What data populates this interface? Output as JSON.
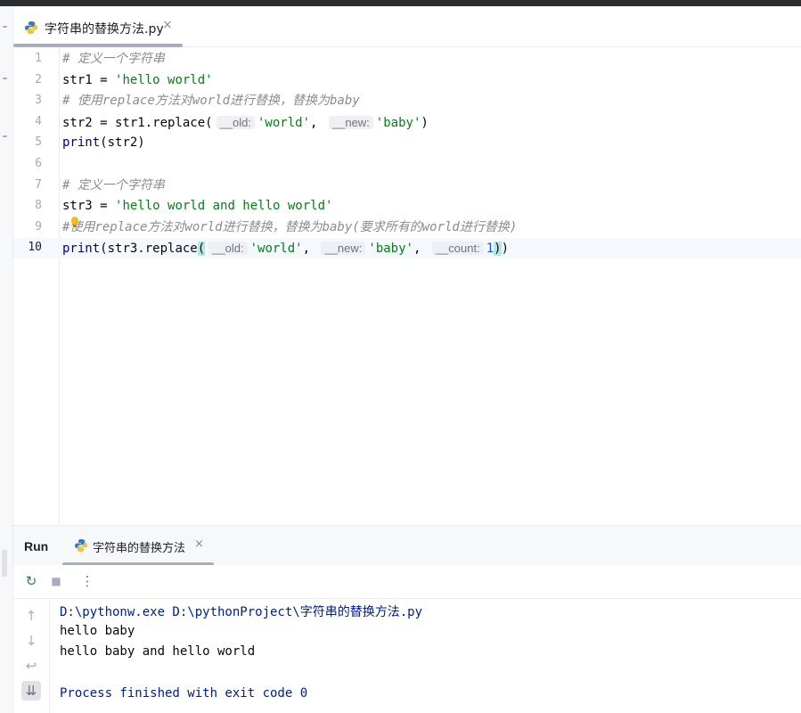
{
  "editor": {
    "tab": {
      "title": "字符串的替换方法.py",
      "close": "×"
    },
    "lines": [
      {
        "num": "1",
        "tokens": [
          {
            "t": "# 定义一个字符串",
            "c": "cm"
          }
        ]
      },
      {
        "num": "2",
        "tokens": [
          {
            "t": "str1 = ",
            "c": ""
          },
          {
            "t": "'hello world'",
            "c": "str"
          }
        ]
      },
      {
        "num": "3",
        "tokens": [
          {
            "t": "# 使用replace方法对world进行替换，替换为baby",
            "c": "cm"
          }
        ]
      },
      {
        "num": "4",
        "tokens": [
          {
            "t": "str2 = str1.replace(",
            "c": ""
          },
          {
            "t": "__old:",
            "c": "hint"
          },
          {
            "t": "'world'",
            "c": "str"
          },
          {
            "t": ", ",
            "c": ""
          },
          {
            "t": "__new:",
            "c": "hint"
          },
          {
            "t": "'baby'",
            "c": "str"
          },
          {
            "t": ")",
            "c": ""
          }
        ]
      },
      {
        "num": "5",
        "tokens": [
          {
            "t": "print",
            "c": "fn"
          },
          {
            "t": "(str2)",
            "c": ""
          }
        ]
      },
      {
        "num": "6",
        "tokens": []
      },
      {
        "num": "7",
        "tokens": [
          {
            "t": "# 定义一个字符串",
            "c": "cm"
          }
        ]
      },
      {
        "num": "8",
        "tokens": [
          {
            "t": "str3 = ",
            "c": ""
          },
          {
            "t": "'hello world and hello world'",
            "c": "str"
          }
        ]
      },
      {
        "num": "9",
        "tokens": [
          {
            "t": "#使用replace方法对world进行替换，替换为baby(要求所有的world进行替换)",
            "c": "cm"
          }
        ]
      },
      {
        "num": "10",
        "current": true,
        "tokens": [
          {
            "t": "print",
            "c": "fn"
          },
          {
            "t": "(str3.replace",
            "c": ""
          },
          {
            "t": "(",
            "c": "pm"
          },
          {
            "t": "__old:",
            "c": "hint"
          },
          {
            "t": "'world'",
            "c": "str"
          },
          {
            "t": ", ",
            "c": ""
          },
          {
            "t": "__new:",
            "c": "hint"
          },
          {
            "t": "'baby'",
            "c": "str"
          },
          {
            "t": ", ",
            "c": ""
          },
          {
            "t": "__count:",
            "c": "hint"
          },
          {
            "t": "1",
            "c": "num"
          },
          {
            "t": ")",
            "c": "pm"
          },
          {
            "t": ")",
            "c": ""
          }
        ]
      }
    ]
  },
  "run": {
    "title": "Run",
    "tab": {
      "title": "字符串的替换方法",
      "close": "×"
    },
    "toolbar": {
      "rerun": "↻",
      "stop": "■",
      "more": "⋮"
    },
    "side": {
      "up": "↑",
      "down": "↓",
      "wrap": "↩",
      "scroll_end": "⇊"
    },
    "console": [
      {
        "text": "D:\\pythonw.exe D:\\pythonProject\\字符串的替换方法.py",
        "kind": "cmd"
      },
      {
        "text": "hello baby",
        "kind": "out"
      },
      {
        "text": "hello baby and hello world",
        "kind": "out"
      },
      {
        "text": "",
        "kind": "out"
      },
      {
        "text": "Process finished with exit code 0",
        "kind": "done"
      }
    ]
  },
  "colors": {
    "comment": "#8c8c8c",
    "string": "#067d17",
    "builtin": "#000080",
    "number": "#1750eb",
    "console_system": "#00208a"
  }
}
